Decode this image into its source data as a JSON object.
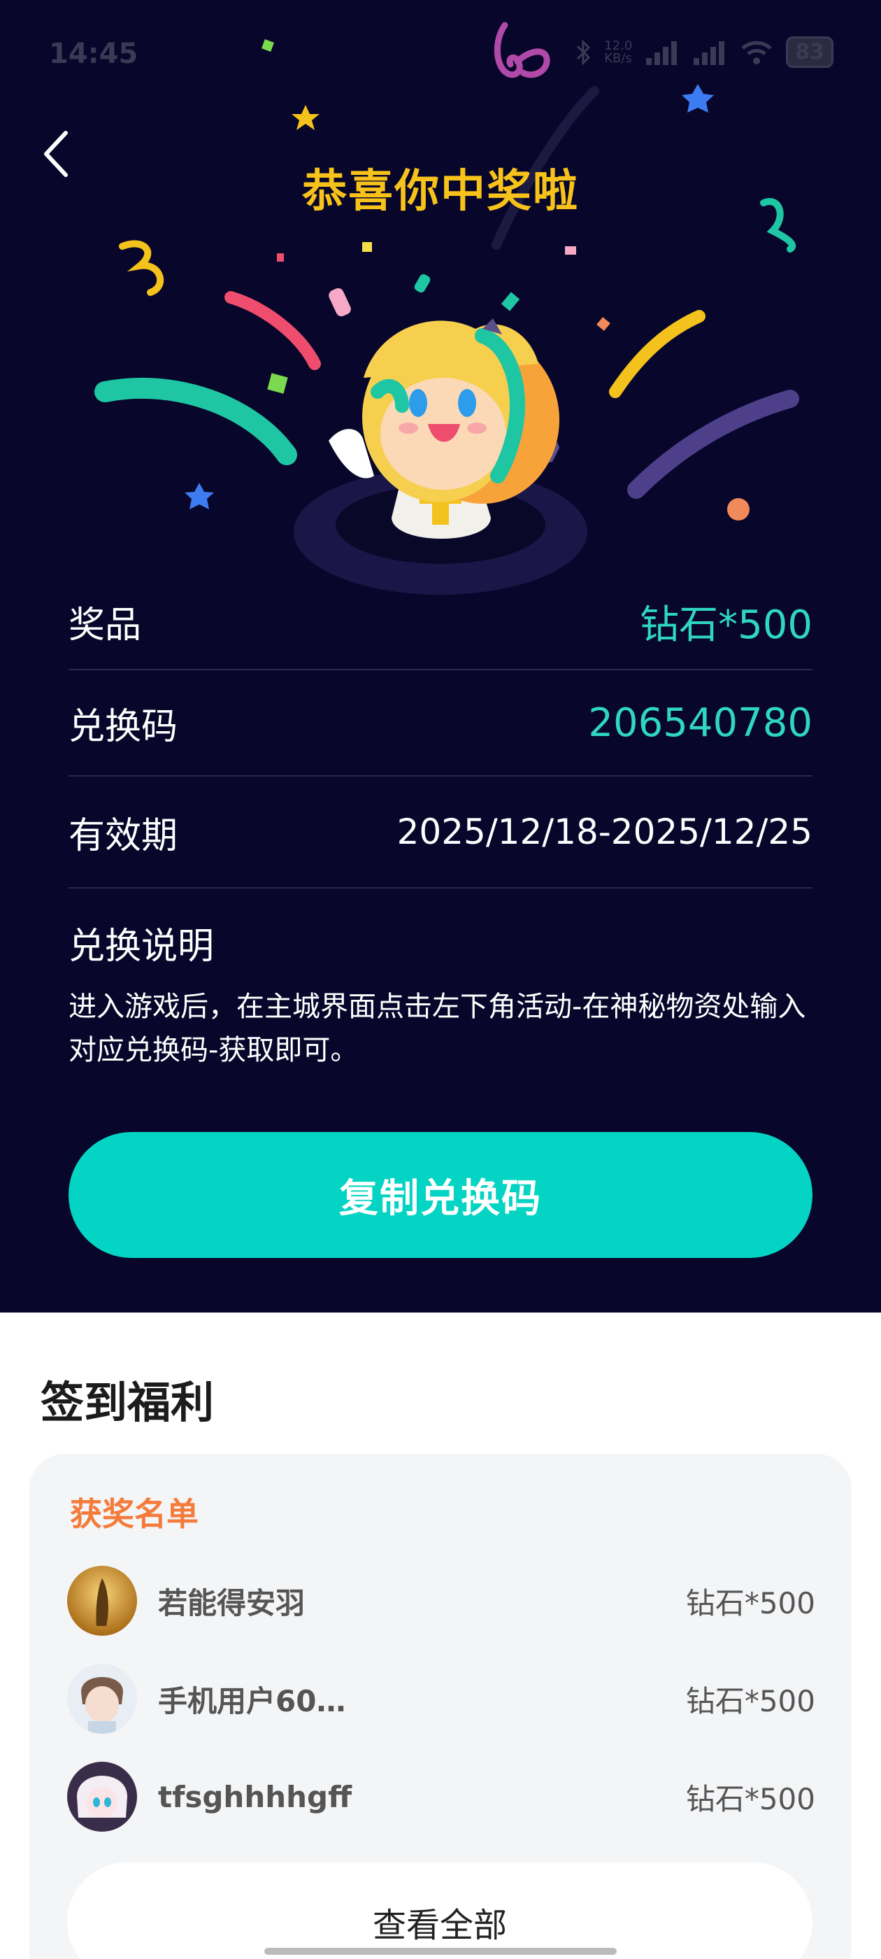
{
  "status_bar": {
    "time": "14:45",
    "network_speed": "12.0\nKB/s",
    "battery": "83"
  },
  "header": {
    "title": "恭喜你中奖啦"
  },
  "prize_info": {
    "rows": [
      {
        "label": "奖品",
        "value": "钻石*500"
      },
      {
        "label": "兑换码",
        "value": "206540780"
      },
      {
        "label": "有效期",
        "value": "2025/12/18-2025/12/25"
      }
    ],
    "instructions_title": "兑换说明",
    "instructions_text": "进入游戏后，在主城界面点击左下角活动-在神秘物资处输入对应兑换码-获取即可。",
    "copy_button": "复制兑换码"
  },
  "signin": {
    "section_title": "签到福利",
    "winners_title": "获奖名单",
    "winners": [
      {
        "name": "若能得安羽",
        "prize": "钻石*500"
      },
      {
        "name": "手机用户60…",
        "prize": "钻石*500"
      },
      {
        "name": "tfsghhhhgff",
        "prize": "钻石*500"
      }
    ],
    "view_all": "查看全部"
  },
  "colors": {
    "background_dark": "#08062a",
    "accent_teal": "#03d4c3",
    "title_yellow": "#f7c21a",
    "winners_orange": "#f47b3a"
  }
}
